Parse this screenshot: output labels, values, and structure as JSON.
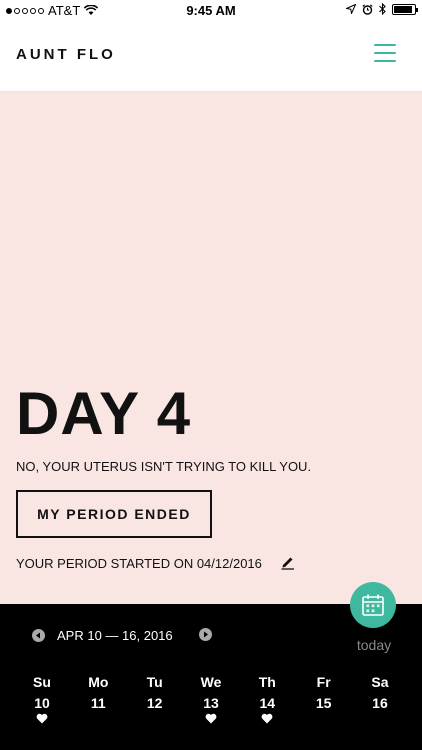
{
  "status_bar": {
    "carrier": "AT&T",
    "time": "9:45 AM",
    "signal_filled": 1,
    "signal_total": 5,
    "battery_level": 0.9
  },
  "header": {
    "title": "AUNT FLO",
    "menu_icon": "hamburger-icon"
  },
  "hero": {
    "day_label": "DAY 4",
    "tagline": "NO, YOUR UTERUS ISN'T TRYING TO KILL YOU.",
    "period_ended_button": "MY PERIOD ENDED",
    "started_text": "YOUR PERIOD STARTED ON 04/12/2016",
    "edit_icon": "pencil-icon"
  },
  "today_button": {
    "label": "today",
    "icon": "calendar-icon"
  },
  "calendar": {
    "range_label": "APR 10 — 16, 2016",
    "days": [
      {
        "name": "Su",
        "num": "10",
        "heart": true
      },
      {
        "name": "Mo",
        "num": "11",
        "heart": false
      },
      {
        "name": "Tu",
        "num": "12",
        "heart": false
      },
      {
        "name": "We",
        "num": "13",
        "heart": true
      },
      {
        "name": "Th",
        "num": "14",
        "heart": true
      },
      {
        "name": "Fr",
        "num": "15",
        "heart": false
      },
      {
        "name": "Sa",
        "num": "16",
        "heart": false
      }
    ]
  },
  "colors": {
    "accent": "#3fb8a0",
    "hero_bg": "#f9e6e3",
    "calendar_bg": "#000000",
    "today_label": "#888888"
  }
}
